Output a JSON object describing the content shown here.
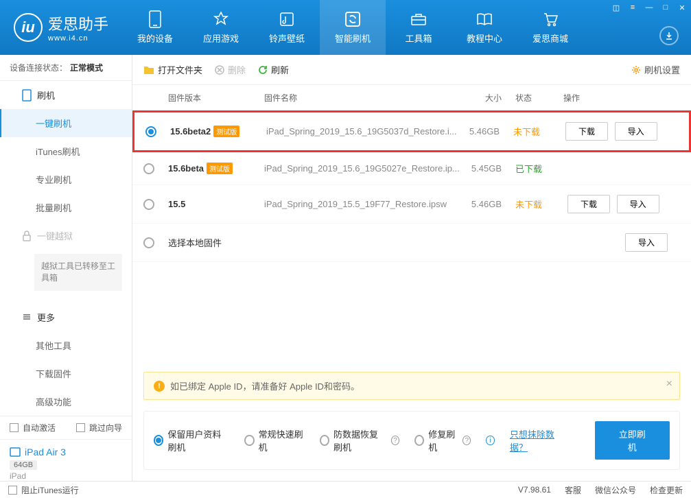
{
  "app": {
    "name": "爱思助手",
    "domain": "www.i4.cn"
  },
  "nav": {
    "items": [
      {
        "label": "我的设备"
      },
      {
        "label": "应用游戏"
      },
      {
        "label": "铃声壁纸"
      },
      {
        "label": "智能刷机"
      },
      {
        "label": "工具箱"
      },
      {
        "label": "教程中心"
      },
      {
        "label": "爱思商城"
      }
    ]
  },
  "sidebar": {
    "status_label": "设备连接状态：",
    "status_value": "正常模式",
    "flash_section": "刷机",
    "items": [
      "一键刷机",
      "iTunes刷机",
      "专业刷机",
      "批量刷机"
    ],
    "jailbreak": "一键越狱",
    "jailbreak_note": "越狱工具已转移至工具箱",
    "more_section": "更多",
    "more_items": [
      "其他工具",
      "下载固件",
      "高级功能"
    ],
    "auto_activate": "自动激活",
    "skip_guide": "跳过向导",
    "device": {
      "name": "iPad Air 3",
      "storage": "64GB",
      "type": "iPad"
    }
  },
  "toolbar": {
    "open_folder": "打开文件夹",
    "delete": "删除",
    "refresh": "刷新",
    "settings": "刷机设置"
  },
  "table": {
    "headers": {
      "version": "固件版本",
      "name": "固件名称",
      "size": "大小",
      "status": "状态",
      "ops": "操作"
    },
    "rows": [
      {
        "version": "15.6beta2",
        "beta": "测试版",
        "name": "iPad_Spring_2019_15.6_19G5037d_Restore.i...",
        "size": "5.46GB",
        "status": "未下载",
        "status_cls": "status-orange",
        "checked": true,
        "download": "下载",
        "import": "导入"
      },
      {
        "version": "15.6beta",
        "beta": "测试版",
        "name": "iPad_Spring_2019_15.6_19G5027e_Restore.ip...",
        "size": "5.45GB",
        "status": "已下载",
        "status_cls": "status-green",
        "checked": false
      },
      {
        "version": "15.5",
        "beta": "",
        "name": "iPad_Spring_2019_15.5_19F77_Restore.ipsw",
        "size": "5.46GB",
        "status": "未下载",
        "status_cls": "status-orange",
        "checked": false,
        "download": "下载",
        "import": "导入"
      }
    ],
    "local_row": {
      "label": "选择本地固件",
      "import": "导入"
    }
  },
  "notice": "如已绑定 Apple ID，请准备好 Apple ID和密码。",
  "options": {
    "items": [
      "保留用户资料刷机",
      "常规快速刷机",
      "防数据恢复刷机",
      "修复刷机"
    ],
    "erase_link": "只想抹除数据？",
    "flash_btn": "立即刷机"
  },
  "footer": {
    "block_itunes": "阻止iTunes运行",
    "version": "V7.98.61",
    "items": [
      "客服",
      "微信公众号",
      "检查更新"
    ]
  }
}
